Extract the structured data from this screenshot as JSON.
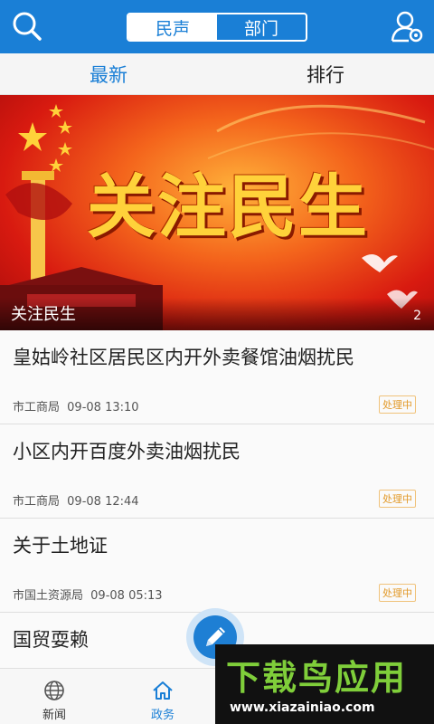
{
  "header": {
    "segments": [
      "民声",
      "部门"
    ],
    "active_segment": "民声",
    "search_icon": "search-icon",
    "user_icon": "user-settings-icon",
    "color": "#1a7fd6"
  },
  "subtabs": {
    "items": [
      "最新",
      "排行"
    ],
    "active": "最新"
  },
  "banner": {
    "image_text": "关注民生",
    "caption": "关注民生",
    "counter": "2"
  },
  "list": [
    {
      "title": "皇姑岭社区居民区内开外卖餐馆油烟扰民",
      "dept": "市工商局",
      "time": "09-08 13:10",
      "status": "处理中"
    },
    {
      "title": "小区内开百度外卖油烟扰民",
      "dept": "市工商局",
      "time": "09-08 12:44",
      "status": "处理中"
    },
    {
      "title": "关于土地证",
      "dept": "市国土资源局",
      "time": "09-08 05:13",
      "status": "处理中"
    },
    {
      "title": "国贸耍赖",
      "dept": "",
      "time": "",
      "status": ""
    }
  ],
  "fab": {
    "icon": "pencil-icon"
  },
  "bottom_nav": [
    {
      "label": "新闻",
      "icon": "globe-icon"
    },
    {
      "label": "政务",
      "icon": "home-icon",
      "active": true
    }
  ],
  "watermark": {
    "main": "下载鸟应用",
    "url": "www.xiazainiao.com"
  }
}
